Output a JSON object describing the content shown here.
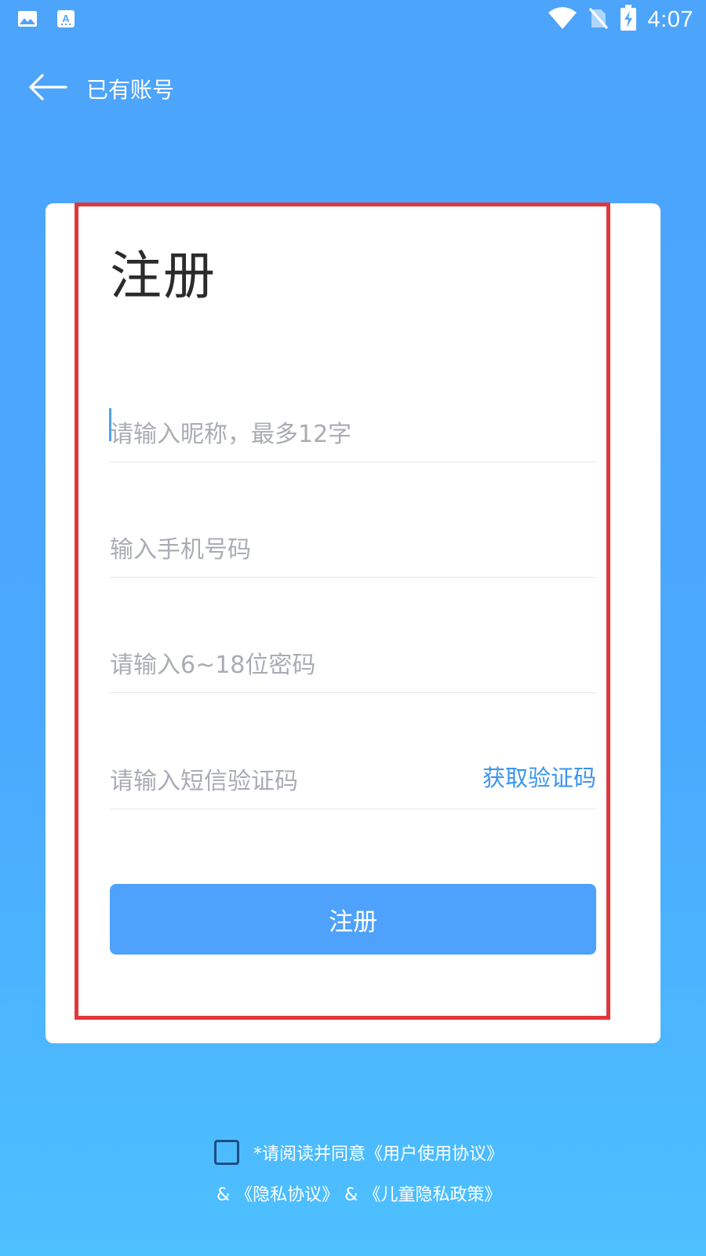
{
  "status_bar": {
    "time": "4:07",
    "icons": [
      "gallery-icon",
      "text-app-icon",
      "wifi-icon",
      "no-sim-icon",
      "battery-charging-icon"
    ]
  },
  "nav": {
    "back_icon": "arrow-left-icon",
    "title": "已有账号"
  },
  "form": {
    "title": "注册",
    "nickname_placeholder": "请输入昵称，最多12字",
    "phone_placeholder": "输入手机号码",
    "password_placeholder": "请输入6~18位密码",
    "code_placeholder": "请输入短信验证码",
    "get_code_label": "获取验证码",
    "submit_label": "注册"
  },
  "agreement": {
    "line1_prefix": "*请阅读并同意",
    "user_agreement": "《用户使用协议》",
    "amp1": "&",
    "privacy_agreement": "《隐私协议》",
    "amp2": "&",
    "child_privacy": "《儿童隐私政策》"
  },
  "colors": {
    "background_top": "#4da4fb",
    "background_bottom": "#4dc0ff",
    "accent": "#4ea2fb",
    "link": "#3b95ee",
    "highlight_frame": "#e0373d"
  }
}
